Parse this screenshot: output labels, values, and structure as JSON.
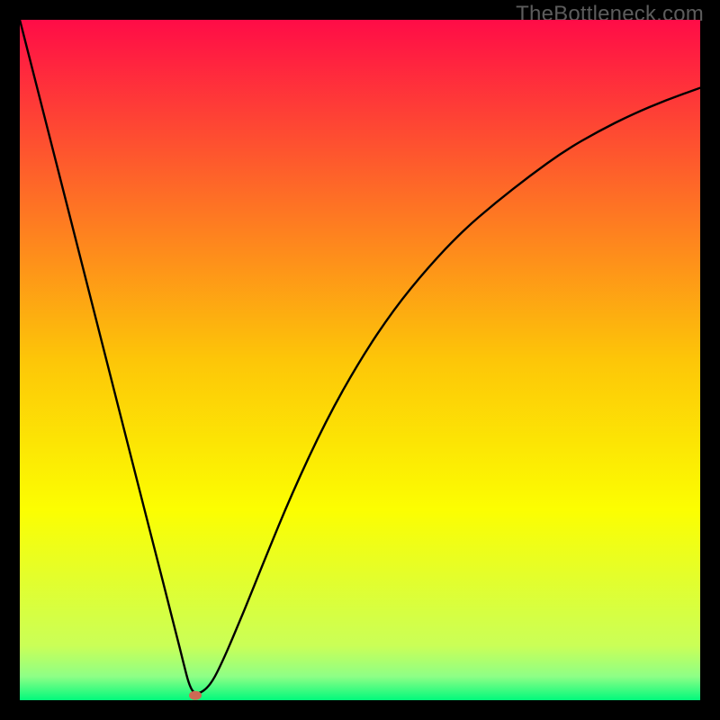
{
  "branding": {
    "watermark": "TheBottleneck.com"
  },
  "chart_data": {
    "type": "line",
    "title": "",
    "xlabel": "",
    "ylabel": "",
    "xlim": [
      0,
      100
    ],
    "ylim": [
      0,
      100
    ],
    "grid": false,
    "legend": false,
    "background_gradient": {
      "stops": [
        {
          "offset": 0.0,
          "color": "#ff0c47"
        },
        {
          "offset": 0.25,
          "color": "#fe6a27"
        },
        {
          "offset": 0.5,
          "color": "#fdc608"
        },
        {
          "offset": 0.72,
          "color": "#fcfe01"
        },
        {
          "offset": 0.92,
          "color": "#caff57"
        },
        {
          "offset": 0.965,
          "color": "#8eff86"
        },
        {
          "offset": 1.0,
          "color": "#02f97c"
        }
      ]
    },
    "series": [
      {
        "name": "bottleneck-curve",
        "x": [
          0,
          5,
          10,
          15,
          18,
          20,
          22,
          23,
          24,
          25,
          26,
          28,
          30,
          33,
          36,
          40,
          45,
          50,
          55,
          60,
          65,
          70,
          75,
          80,
          85,
          90,
          95,
          100
        ],
        "y": [
          100,
          80.4,
          60.7,
          41.1,
          29.3,
          21.5,
          13.6,
          9.7,
          5.7,
          1.8,
          0.7,
          2.1,
          6.1,
          13.2,
          20.7,
          30.4,
          41.1,
          50.0,
          57.5,
          63.6,
          68.9,
          73.2,
          77.1,
          80.7,
          83.6,
          86.1,
          88.2,
          90.0
        ]
      }
    ],
    "marker": {
      "name": "current-point",
      "x": 25.8,
      "y": 0.7,
      "color": "#cc6a54",
      "rx": 7,
      "ry": 5
    }
  },
  "colors": {
    "frame": "#000000",
    "curve": "#000000",
    "watermark": "#5c5c5c"
  }
}
